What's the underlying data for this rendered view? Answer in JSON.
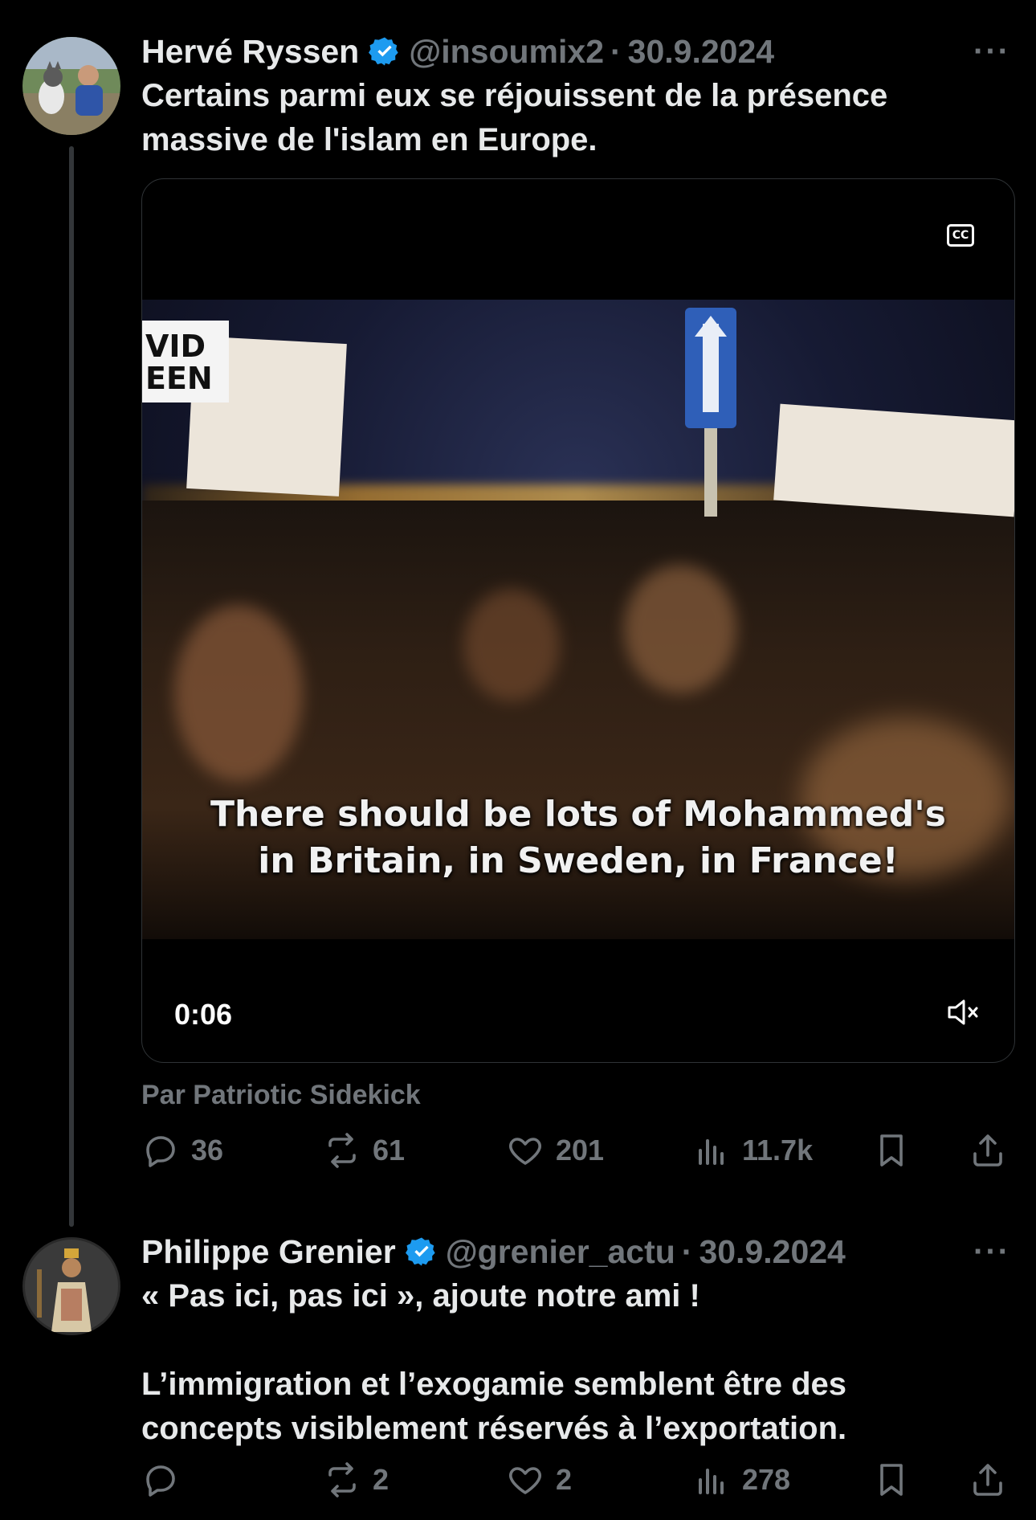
{
  "tweets": [
    {
      "author_name": "Hervé Ryssen",
      "handle": "@insoumix2",
      "separator": "·",
      "date": "30.9.2024",
      "more": "···",
      "text": "Certains parmi eux se réjouissent de la présence\nmassive de l'islam en Europe.",
      "video": {
        "caption_line1": "There should be lots of Mohammed's",
        "caption_line2": "in Britain, in Sweden, in France!",
        "logo_text_1": "VID",
        "logo_text_2": "EEN",
        "duration": "0:06",
        "cc_label": "CC"
      },
      "attribution": "Par Patriotic Sidekick",
      "stats": {
        "replies": "36",
        "reposts": "61",
        "likes": "201",
        "views": "11.7k"
      }
    },
    {
      "author_name": "Philippe Grenier",
      "handle": "@grenier_actu",
      "separator": "·",
      "date": "30.9.2024",
      "more": "···",
      "text": "« Pas ici, pas ici », ajoute notre ami !\n\nL’immigration et l’exogamie semblent être des\nconcepts visiblement réservés à l’exportation.",
      "stats": {
        "replies": "",
        "reposts": "2",
        "likes": "2",
        "views": "278"
      }
    }
  ],
  "colors": {
    "background": "#000000",
    "text": "#e7e9ea",
    "muted": "#71767b",
    "verified": "#1d9bf0",
    "divider": "#2f3336"
  }
}
